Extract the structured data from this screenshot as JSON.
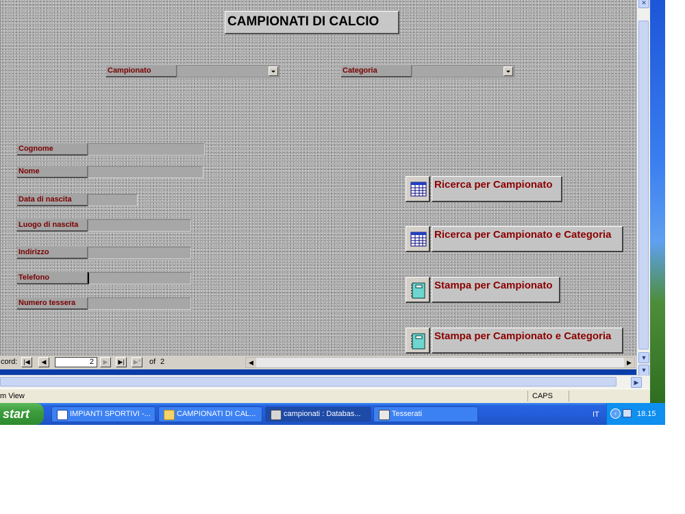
{
  "form": {
    "title": "CAMPIONATI DI CALCIO",
    "filters": [
      {
        "label": "Campionato",
        "value": ""
      },
      {
        "label": "Categoria",
        "value": ""
      }
    ],
    "fields": [
      {
        "label": "Cognome",
        "value": ""
      },
      {
        "label": "Nome",
        "value": ""
      },
      {
        "label": "Data di nascita",
        "value": ""
      },
      {
        "label": "Luogo di nascita",
        "value": ""
      },
      {
        "label": "Indirizzo",
        "value": ""
      },
      {
        "label": "Telefono",
        "value": ""
      },
      {
        "label": "Numero tessera",
        "value": ""
      }
    ],
    "commands": [
      {
        "label": "Ricerca per Campionato",
        "icon": "table-icon"
      },
      {
        "label": "Ricerca per Campionato e Categoria",
        "icon": "table-icon"
      },
      {
        "label": "Stampa per Campionato",
        "icon": "report-icon"
      },
      {
        "label": "Stampa per Campionato e Categoria",
        "icon": "report-icon"
      }
    ]
  },
  "navigator": {
    "record_label": "cord:",
    "current": "2",
    "of_label": "of",
    "total": "2"
  },
  "status_bar": {
    "view": "m View",
    "caps": "CAPS"
  },
  "taskbar": {
    "start": "start",
    "tasks": [
      {
        "label": "IMPIANTI SPORTIVI -...",
        "icon": "word-icon"
      },
      {
        "label": "CAMPIONATI DI CAL...",
        "icon": "folder-icon"
      },
      {
        "label": "campionati : Databas...",
        "icon": "access-icon"
      },
      {
        "label": "Tesserati",
        "icon": "form-icon"
      }
    ],
    "language": "IT",
    "clock": "18.15"
  },
  "colors": {
    "label_text": "#7a0000",
    "command_text": "#8b0000",
    "taskbar": "#245edb",
    "start_green": "#3c9c3c"
  }
}
